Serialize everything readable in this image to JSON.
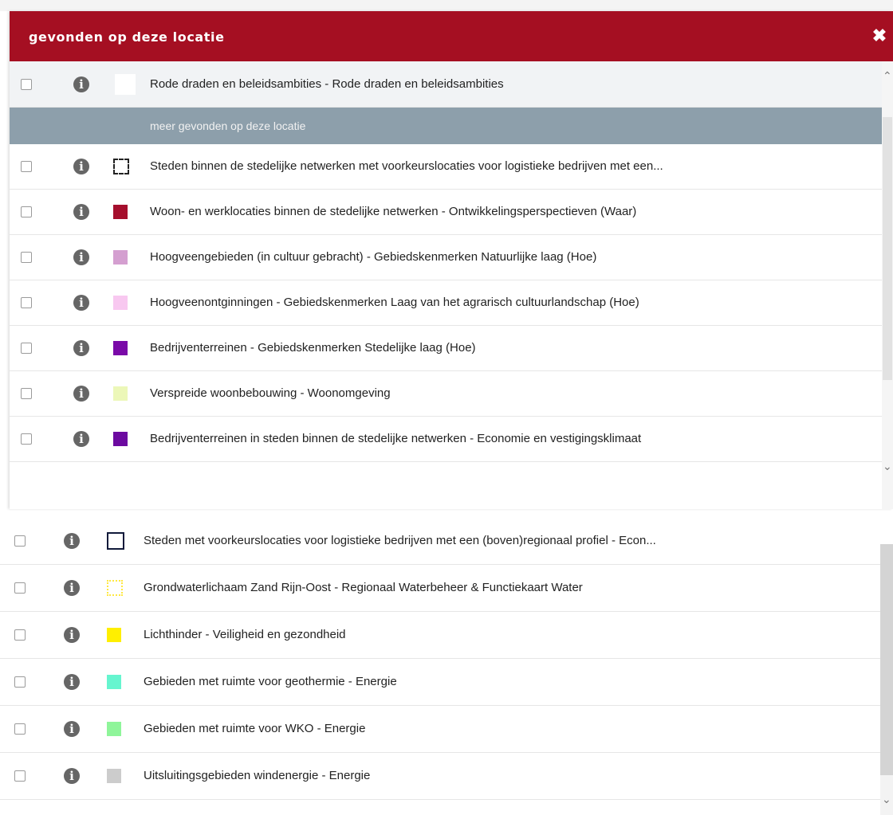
{
  "panel": {
    "title": "gevonden op deze locatie",
    "close_glyph": "✖",
    "first_row": {
      "label": "Rode draden en beleidsambities - Rode draden en beleidsambities",
      "swatch": "#ffffff"
    },
    "subheader": "meer gevonden op deze locatie",
    "rows": [
      {
        "label": "Steden binnen de stedelijke netwerken met voorkeurslocaties voor logistieke bedrijven met een...",
        "swatch": "dashed"
      },
      {
        "label": "Woon- en werklocaties binnen de stedelijke netwerken - Ontwikkelingsperspectieven (Waar)",
        "swatch": "#a50f2d"
      },
      {
        "label": "Hoogveengebieden (in cultuur gebracht) - Gebiedskenmerken Natuurlijke laag (Hoe)",
        "swatch": "#d49fd0"
      },
      {
        "label": "Hoogveenontginningen - Gebiedskenmerken Laag van het agrarisch cultuurlandschap (Hoe)",
        "swatch": "#f8c8f0"
      },
      {
        "label": "Bedrijventerreinen - Gebiedskenmerken Stedelijke laag (Hoe)",
        "swatch": "#7a0aa8"
      },
      {
        "label": "Verspreide woonbebouwing - Woonomgeving",
        "swatch": "#ecf7b8"
      },
      {
        "label": "Bedrijventerreinen in steden binnen de stedelijke netwerken - Economie en vestigingsklimaat",
        "swatch": "#6c0aa0"
      }
    ]
  },
  "lower_list": {
    "rows": [
      {
        "label": "Steden met voorkeurslocaties voor logistieke bedrijven met een (boven)regionaal profiel - Econ...",
        "swatch": "outline"
      },
      {
        "label": "Grondwaterlichaam Zand Rijn-Oost - Regionaal Waterbeheer & Functiekaart Water",
        "swatch": "dotted"
      },
      {
        "label": "Lichthinder - Veiligheid en gezondheid",
        "swatch": "#ffef00"
      },
      {
        "label": "Gebieden met ruimte voor geothermie - Energie",
        "swatch": "#66f5cf"
      },
      {
        "label": "Gebieden met ruimte voor WKO - Energie",
        "swatch": "#8ff59a"
      },
      {
        "label": "Uitsluitingsgebieden windenergie - Energie",
        "swatch": "#cccccc"
      }
    ]
  },
  "icons": {
    "info": "i",
    "scroll_up": "⌃",
    "scroll_down": "⌄"
  },
  "colors": {
    "header": "#a50f22",
    "subheader": "#8d9fab"
  }
}
